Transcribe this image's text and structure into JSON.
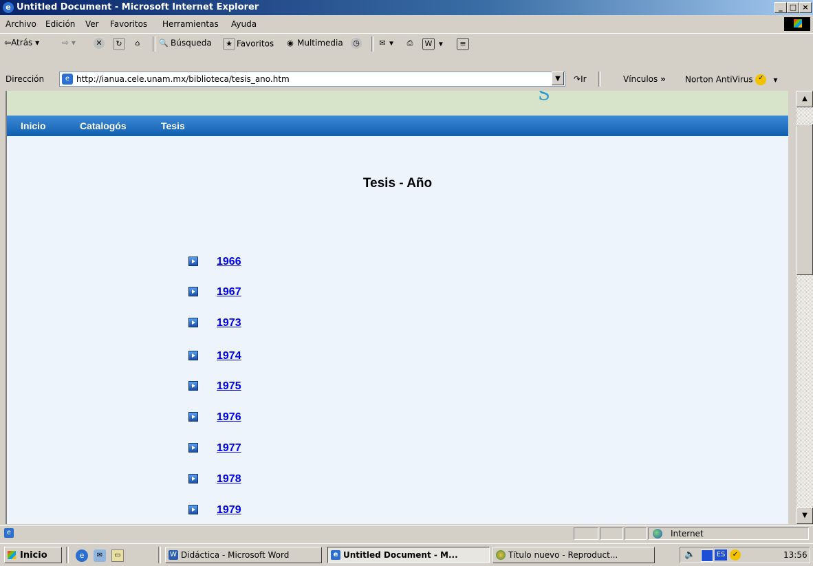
{
  "window": {
    "title": "Untitled Document - Microsoft Internet Explorer",
    "controls": {
      "minimize": "_",
      "maximize": "□",
      "close": "×"
    }
  },
  "menu": [
    "Archivo",
    "Edición",
    "Ver",
    "Favoritos",
    "Herramientas",
    "Ayuda"
  ],
  "toolbar": {
    "back": "Atrás",
    "search": "Búsqueda",
    "favorites": "Favoritos",
    "media": "Multimedia"
  },
  "address": {
    "label": "Dirección",
    "url": "http://ianua.cele.unam.mx/biblioteca/tesis_ano.htm",
    "go": "Ir",
    "links_label": "Vínculos",
    "links_chevron": "»",
    "norton": "Norton AntiVirus"
  },
  "page": {
    "nav": [
      "Inicio",
      "Catalogós",
      "Tesis"
    ],
    "heading": "Tesis - Año",
    "years": [
      "1966",
      "1967",
      "1973",
      "1974",
      "1975",
      "1976",
      "1977",
      "1978",
      "1979"
    ]
  },
  "status": {
    "zone": "Internet"
  },
  "taskbar": {
    "start": "Inicio",
    "tasks": [
      {
        "label": "Didáctica - Microsoft Word",
        "active": false
      },
      {
        "label": "Untitled Document - M...",
        "active": true
      },
      {
        "label": "Título nuevo - Reproduct...",
        "active": false
      }
    ],
    "lang": "ES",
    "clock": "13:56"
  },
  "colors": {
    "nav_bar": "#1a6fc4",
    "banner": "#d8e4c9",
    "page_bg": "#eef4fc",
    "link": "#0000ee"
  }
}
